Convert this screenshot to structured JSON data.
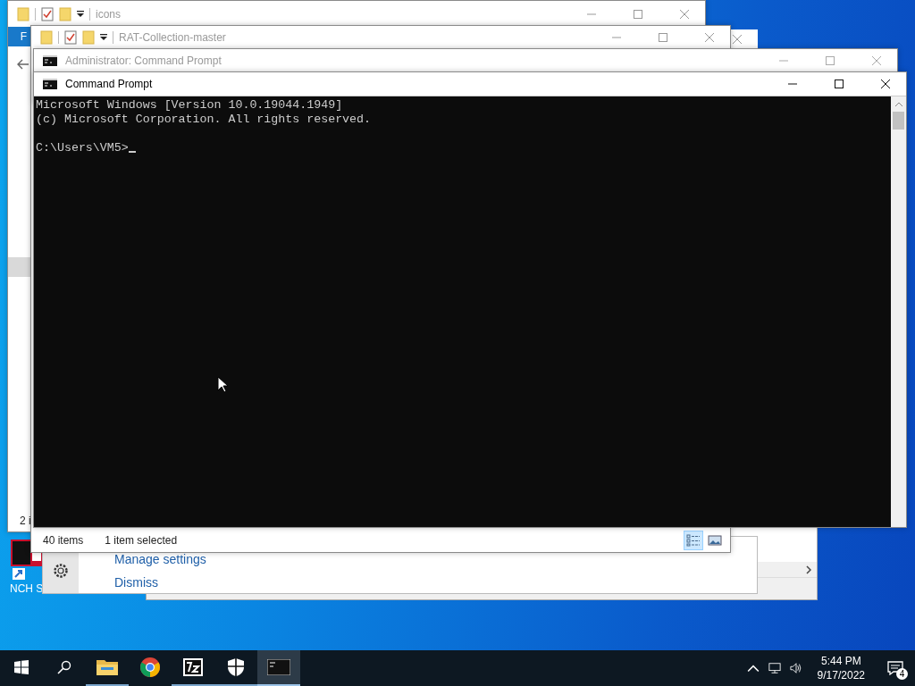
{
  "desktop": {
    "shortcut": {
      "label": "NCH S"
    }
  },
  "windows": [
    {
      "kind": "explorer",
      "title": "icons",
      "active": false,
      "ribbon_tab": "F",
      "back_button": true,
      "status": [
        "2 i"
      ]
    },
    {
      "kind": "explorer",
      "title": "RAT-Collection-master",
      "active": false,
      "status": [
        "40 items",
        "1 item selected"
      ],
      "views": [
        {
          "kind": "details",
          "selected": true
        },
        {
          "kind": "thumbnails",
          "selected": false
        }
      ]
    },
    {
      "kind": "console",
      "title": "Administrator: Command Prompt",
      "active": false
    },
    {
      "kind": "console",
      "title": "Command Prompt",
      "active": true,
      "lines": [
        "Microsoft Windows [Version 10.0.19044.1949]",
        "(c) Microsoft Corporation. All rights reserved."
      ],
      "prompt": "C:\\Users\\VM5>"
    }
  ],
  "notification": {
    "actions": [
      "Manage settings",
      "Dismiss"
    ]
  },
  "taskbar": {
    "apps": [
      {
        "kind": "explorer",
        "running": true,
        "selected": false
      },
      {
        "kind": "chrome",
        "running": false,
        "selected": false
      },
      {
        "kind": "archiver",
        "running": true,
        "selected": false
      },
      {
        "kind": "security",
        "running": true,
        "selected": false
      },
      {
        "kind": "console",
        "running": true,
        "selected": true
      }
    ],
    "time": "5:44 PM",
    "date": "9/17/2022",
    "notification_count": "4"
  }
}
